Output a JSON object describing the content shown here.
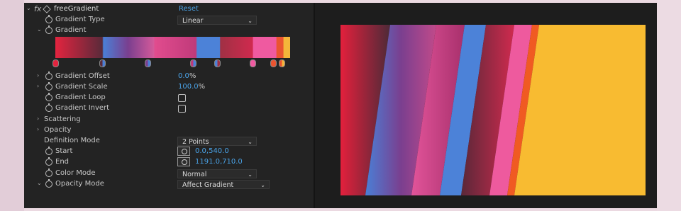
{
  "effect": {
    "fx_label": "fx",
    "name": "freeGradient",
    "reset": "Reset"
  },
  "params": {
    "gradient_type": {
      "label": "Gradient Type",
      "value": "Linear"
    },
    "gradient": {
      "label": "Gradient"
    },
    "gradient_offset": {
      "label": "Gradient Offset",
      "value": "0.0",
      "unit": "%"
    },
    "gradient_scale": {
      "label": "Gradient Scale",
      "value": "100.0",
      "unit": "%"
    },
    "gradient_loop": {
      "label": "Gradient Loop"
    },
    "gradient_invert": {
      "label": "Gradient Invert"
    },
    "scattering": {
      "label": "Scattering"
    },
    "opacity": {
      "label": "Opacity"
    },
    "definition_mode": {
      "label": "Definition Mode",
      "value": "2 Points"
    },
    "start": {
      "label": "Start",
      "value": "0.0,540.0"
    },
    "end": {
      "label": "End",
      "value": "1191.0,710.0"
    },
    "color_mode": {
      "label": "Color Mode",
      "value": "Normal"
    },
    "opacity_mode": {
      "label": "Opacity Mode",
      "value": "Affect Gradient"
    }
  },
  "gradient_stops": [
    {
      "color": "#e3243f"
    },
    {
      "color": "#4a7fd6"
    },
    {
      "color": "#7a3f8f"
    },
    {
      "color": "#d45a9a"
    },
    {
      "color": "#4c82d8"
    },
    {
      "color": "#a03044"
    },
    {
      "color": "#ef5aa0"
    },
    {
      "color": "#ea5430"
    },
    {
      "color": "#f4b63a"
    }
  ],
  "colors": {
    "accent": "#4aa3e8",
    "yellow": "#f8bb31",
    "orange": "#f05a22"
  }
}
